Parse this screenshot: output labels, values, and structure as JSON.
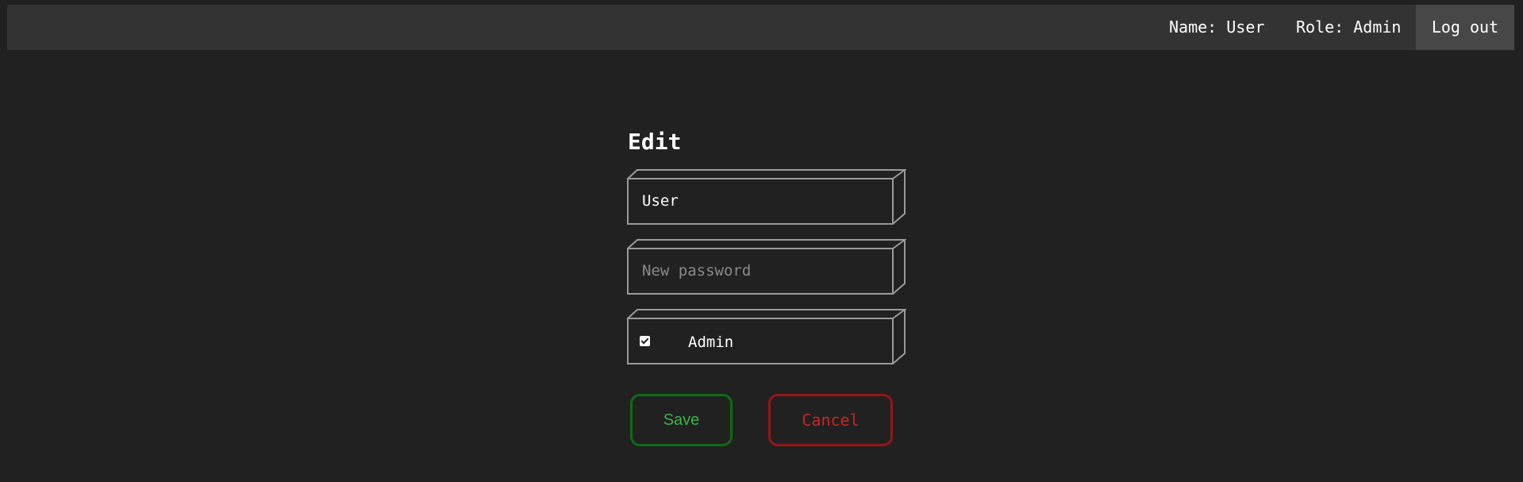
{
  "header": {
    "name_text": "Name: User",
    "role_text": "Role: Admin",
    "logout_label": "Log out"
  },
  "form": {
    "title": "Edit",
    "username_value": "User",
    "password_placeholder": "New password",
    "admin_label": "Admin",
    "admin_checked": true,
    "save_label": "Save",
    "cancel_label": "Cancel"
  },
  "colors": {
    "background": "#212121",
    "topbar": "#333333",
    "logout_bg": "#474747",
    "field_border": "#9a9a9a",
    "save": "#3cb043",
    "cancel": "#c62626"
  }
}
